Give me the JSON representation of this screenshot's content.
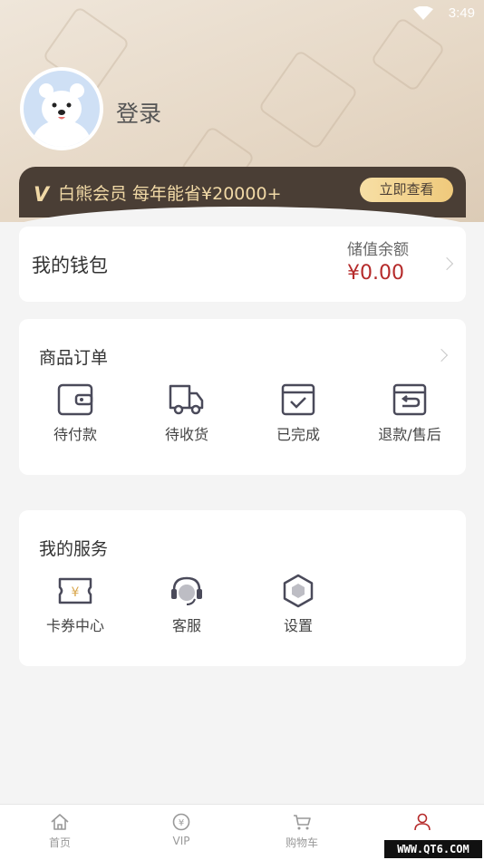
{
  "status_bar": {
    "time": "3:49",
    "wifi_icon": "wifi-icon"
  },
  "profile": {
    "login_label": "登录",
    "avatar_icon": "polar-bear-avatar"
  },
  "vip_banner": {
    "badge": "V",
    "text": "白熊会员 每年能省¥20000+",
    "button_label": "立即查看"
  },
  "wallet": {
    "title": "我的钱包",
    "balance_label": "储值余额",
    "balance_value": "¥0.00"
  },
  "orders": {
    "title": "商品订单",
    "items": [
      {
        "label": "待付款",
        "icon": "wallet-icon"
      },
      {
        "label": "待收货",
        "icon": "truck-icon"
      },
      {
        "label": "已完成",
        "icon": "check-box-icon"
      },
      {
        "label": "退款/售后",
        "icon": "return-box-icon"
      }
    ]
  },
  "services": {
    "title": "我的服务",
    "items": [
      {
        "label": "卡券中心",
        "icon": "coupon-icon"
      },
      {
        "label": "客服",
        "icon": "headset-icon"
      },
      {
        "label": "设置",
        "icon": "hexagon-settings-icon"
      }
    ]
  },
  "tabbar": {
    "items": [
      {
        "label": "首页",
        "icon": "home-icon"
      },
      {
        "label": "VIP",
        "icon": "yen-circle-icon"
      },
      {
        "label": "购物车",
        "icon": "cart-icon"
      },
      {
        "label": "",
        "icon": "person-icon",
        "active": true
      }
    ]
  },
  "watermark": "WWW.QT6.COM",
  "colors": {
    "accent_red": "#b52a2a",
    "vip_dark": "#4a3e35",
    "vip_gold": "#f1d9a6"
  }
}
